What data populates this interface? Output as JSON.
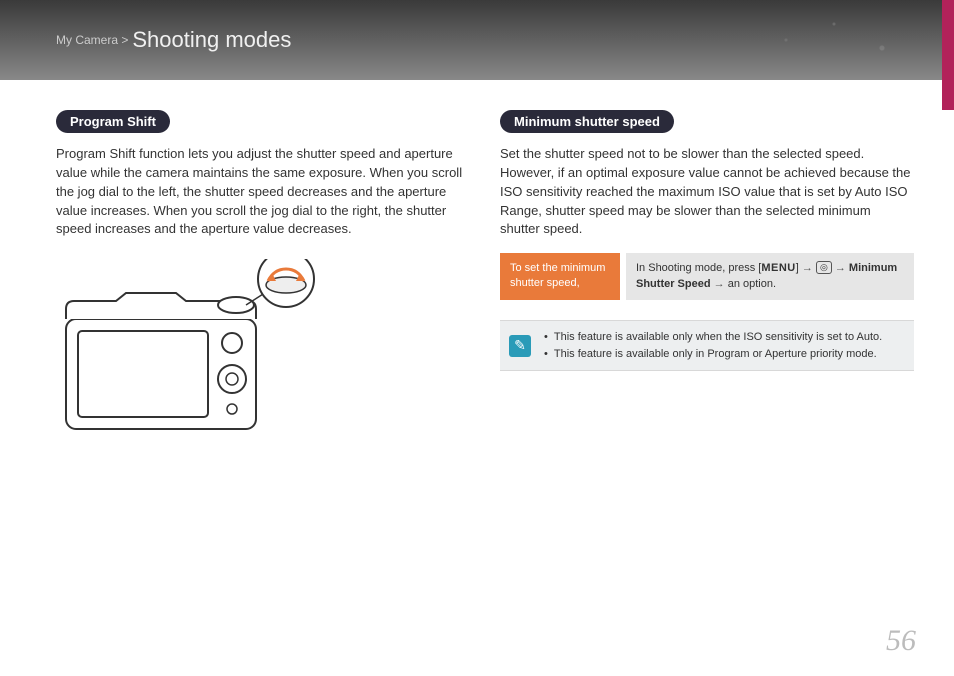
{
  "header": {
    "breadcrumb": "My Camera >",
    "title": "Shooting modes"
  },
  "left": {
    "heading": "Program Shift",
    "body": "Program Shift function lets you adjust the shutter speed and aperture value while the camera maintains the same exposure. When you scroll the jog dial to the left, the shutter speed decreases and the aperture value increases. When you scroll the jog dial to the right, the shutter speed increases and the aperture value decreases."
  },
  "right": {
    "heading": "Minimum shutter speed",
    "body": "Set the shutter speed not to be slower than the selected speed. However, if an optimal exposure value cannot be achieved because the ISO sensitivity reached the maximum ISO value that is set by Auto ISO Range, shutter speed may be slower than the selected minimum shutter speed.",
    "instruction_label": "To set the minimum shutter speed,",
    "instruction_prefix": "In Shooting mode, press [",
    "instruction_menu": "MENU",
    "instruction_mid1": "] ",
    "instruction_arrow": "→",
    "instruction_cam": "◎",
    "instruction_bold": "Minimum Shutter Speed",
    "instruction_suffix": " an option.",
    "notes": [
      "This feature is available only when the ISO sensitivity is set to Auto.",
      "This feature is available only in Program or Aperture priority mode."
    ]
  },
  "page_number": "56"
}
